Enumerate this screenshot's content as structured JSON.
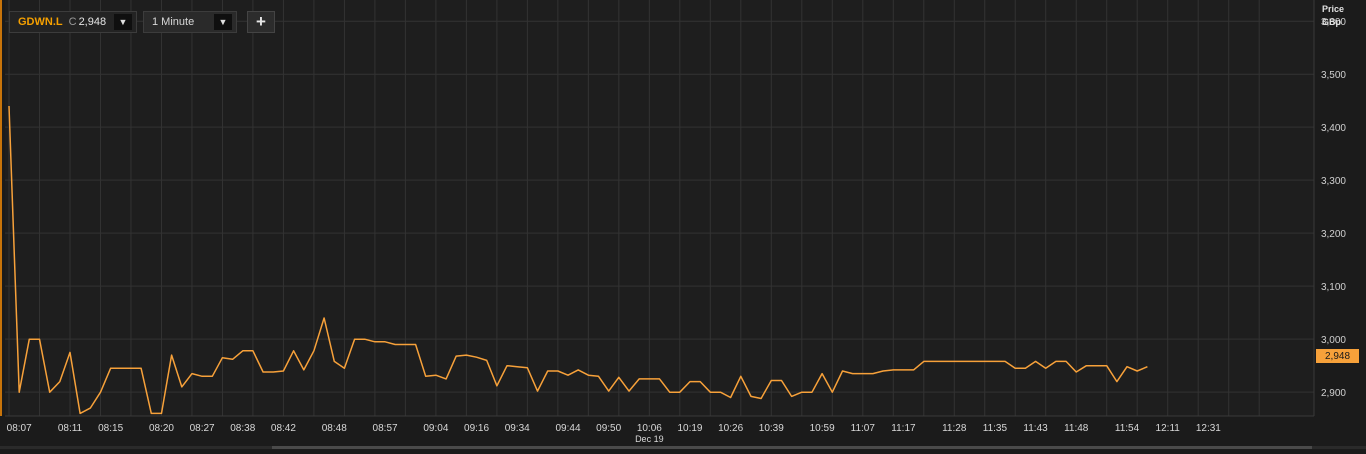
{
  "toolbar": {
    "symbol": "GDWN.L",
    "close_prefix": "C",
    "close_value": "2,948",
    "interval": "1 Minute",
    "dropdown_glyph": "▼",
    "add_glyph": "+"
  },
  "colors": {
    "background": "#1b1b1b",
    "plot_background": "#1e1e1e",
    "grid": "#333333",
    "line": "#f7a13a",
    "symbol": "#f5a000"
  },
  "chart_data": {
    "type": "line",
    "ylabel_line1": "Price",
    "ylabel_line2": "GBp",
    "ylim": [
      2855,
      3640
    ],
    "yticks": [
      2900,
      3000,
      3100,
      3200,
      3300,
      3400,
      3500,
      3600
    ],
    "ytick_labels": [
      "2,900",
      "3,000",
      "3,100",
      "3,200",
      "3,300",
      "3,400",
      "3,500",
      "3,600"
    ],
    "xlim": [
      0,
      128
    ],
    "xticks": [
      0,
      3,
      6,
      9,
      12,
      15,
      18,
      21,
      24,
      27,
      30,
      33,
      36,
      39,
      42,
      45,
      48,
      51,
      54,
      57,
      60,
      63,
      66,
      69,
      72,
      75,
      78,
      81,
      84,
      87,
      90,
      93,
      96,
      99,
      102,
      105,
      108,
      111,
      114,
      117,
      120,
      123
    ],
    "xtick_labels": [
      "08:07",
      "08:11",
      "08:15",
      "08:20",
      "08:27",
      "08:38",
      "08:42",
      "08:48",
      "08:57",
      "09:04",
      "09:16",
      "09:34",
      "09:44",
      "09:50",
      "10:06",
      "10:19",
      "10:26",
      "10:39",
      "10:59",
      "11:07",
      "11:17",
      "11:28",
      "11:35",
      "11:43",
      "11:48",
      "11:54",
      "12:11",
      "12:31"
    ],
    "xtick_label_positions": [
      1,
      6,
      10,
      15,
      19,
      23,
      27,
      32,
      37,
      42,
      46,
      50,
      55,
      59,
      63,
      67,
      71,
      75,
      80,
      84,
      88,
      93,
      97,
      101,
      105,
      110,
      114,
      118
    ],
    "date_label": "Dec 19",
    "date_label_position": 63,
    "grid": true,
    "last_value": 2948,
    "last_value_label": "2,948",
    "series": [
      {
        "values": [
          3440,
          2900,
          3000,
          3000,
          2900,
          2920,
          2975,
          2860,
          2870,
          2900,
          2945,
          2945,
          2945,
          2945,
          2860,
          2860,
          2970,
          2910,
          2935,
          2930,
          2930,
          2965,
          2962,
          2978,
          2978,
          2938,
          2938,
          2940,
          2978,
          2942,
          2978,
          3040,
          2958,
          2945,
          3000,
          3000,
          2995,
          2995,
          2990,
          2990,
          2990,
          2930,
          2932,
          2925,
          2968,
          2970,
          2966,
          2960,
          2912,
          2950,
          2948,
          2946,
          2902,
          2940,
          2940,
          2932,
          2942,
          2932,
          2930,
          2902,
          2928,
          2902,
          2925,
          2925,
          2925,
          2900,
          2900,
          2920,
          2920,
          2900,
          2900,
          2890,
          2930,
          2892,
          2888,
          2922,
          2922,
          2892,
          2900,
          2900,
          2935,
          2900,
          2940,
          2935,
          2935,
          2935,
          2940,
          2942,
          2942,
          2942,
          2958,
          2958,
          2958,
          2958,
          2958,
          2958,
          2958,
          2958,
          2958,
          2945,
          2945,
          2958,
          2945,
          2958,
          2958,
          2938,
          2950,
          2950,
          2950,
          2920,
          2948,
          2940,
          2948
        ]
      }
    ]
  }
}
